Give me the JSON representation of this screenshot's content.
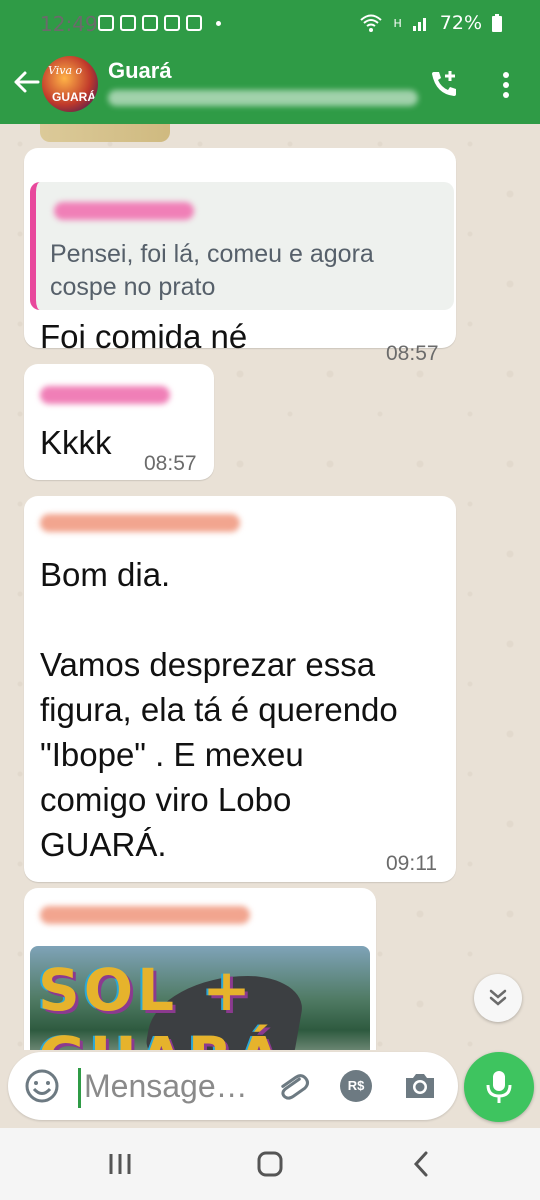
{
  "status_bar": {
    "time": "12:49",
    "battery": "72%",
    "signal_label": "H"
  },
  "header": {
    "title": "Guará",
    "avatar_text_1": "Viva o",
    "avatar_text_2": "GUARÁ"
  },
  "messages": [
    {
      "quoted_text": "Pensei, foi lá, comeu e agora cospe no prato",
      "text": "Foi comida né",
      "time": "08:57"
    },
    {
      "text": "Kkkk",
      "time": "08:57"
    },
    {
      "text": "Bom dia.\n\nVamos desprezar essa figura, ela tá é querendo \"Ibope\" . E mexeu comigo viro Lobo GUARÁ.",
      "time": "09:11"
    },
    {
      "image_caption_text": "SOL + GUARÁ"
    }
  ],
  "composer": {
    "placeholder": "Mensage…",
    "pay_label": "R$"
  },
  "colors": {
    "header_green": "#2f9b46",
    "mic_green": "#3ec45f",
    "quote_bar": "#e8489c"
  }
}
